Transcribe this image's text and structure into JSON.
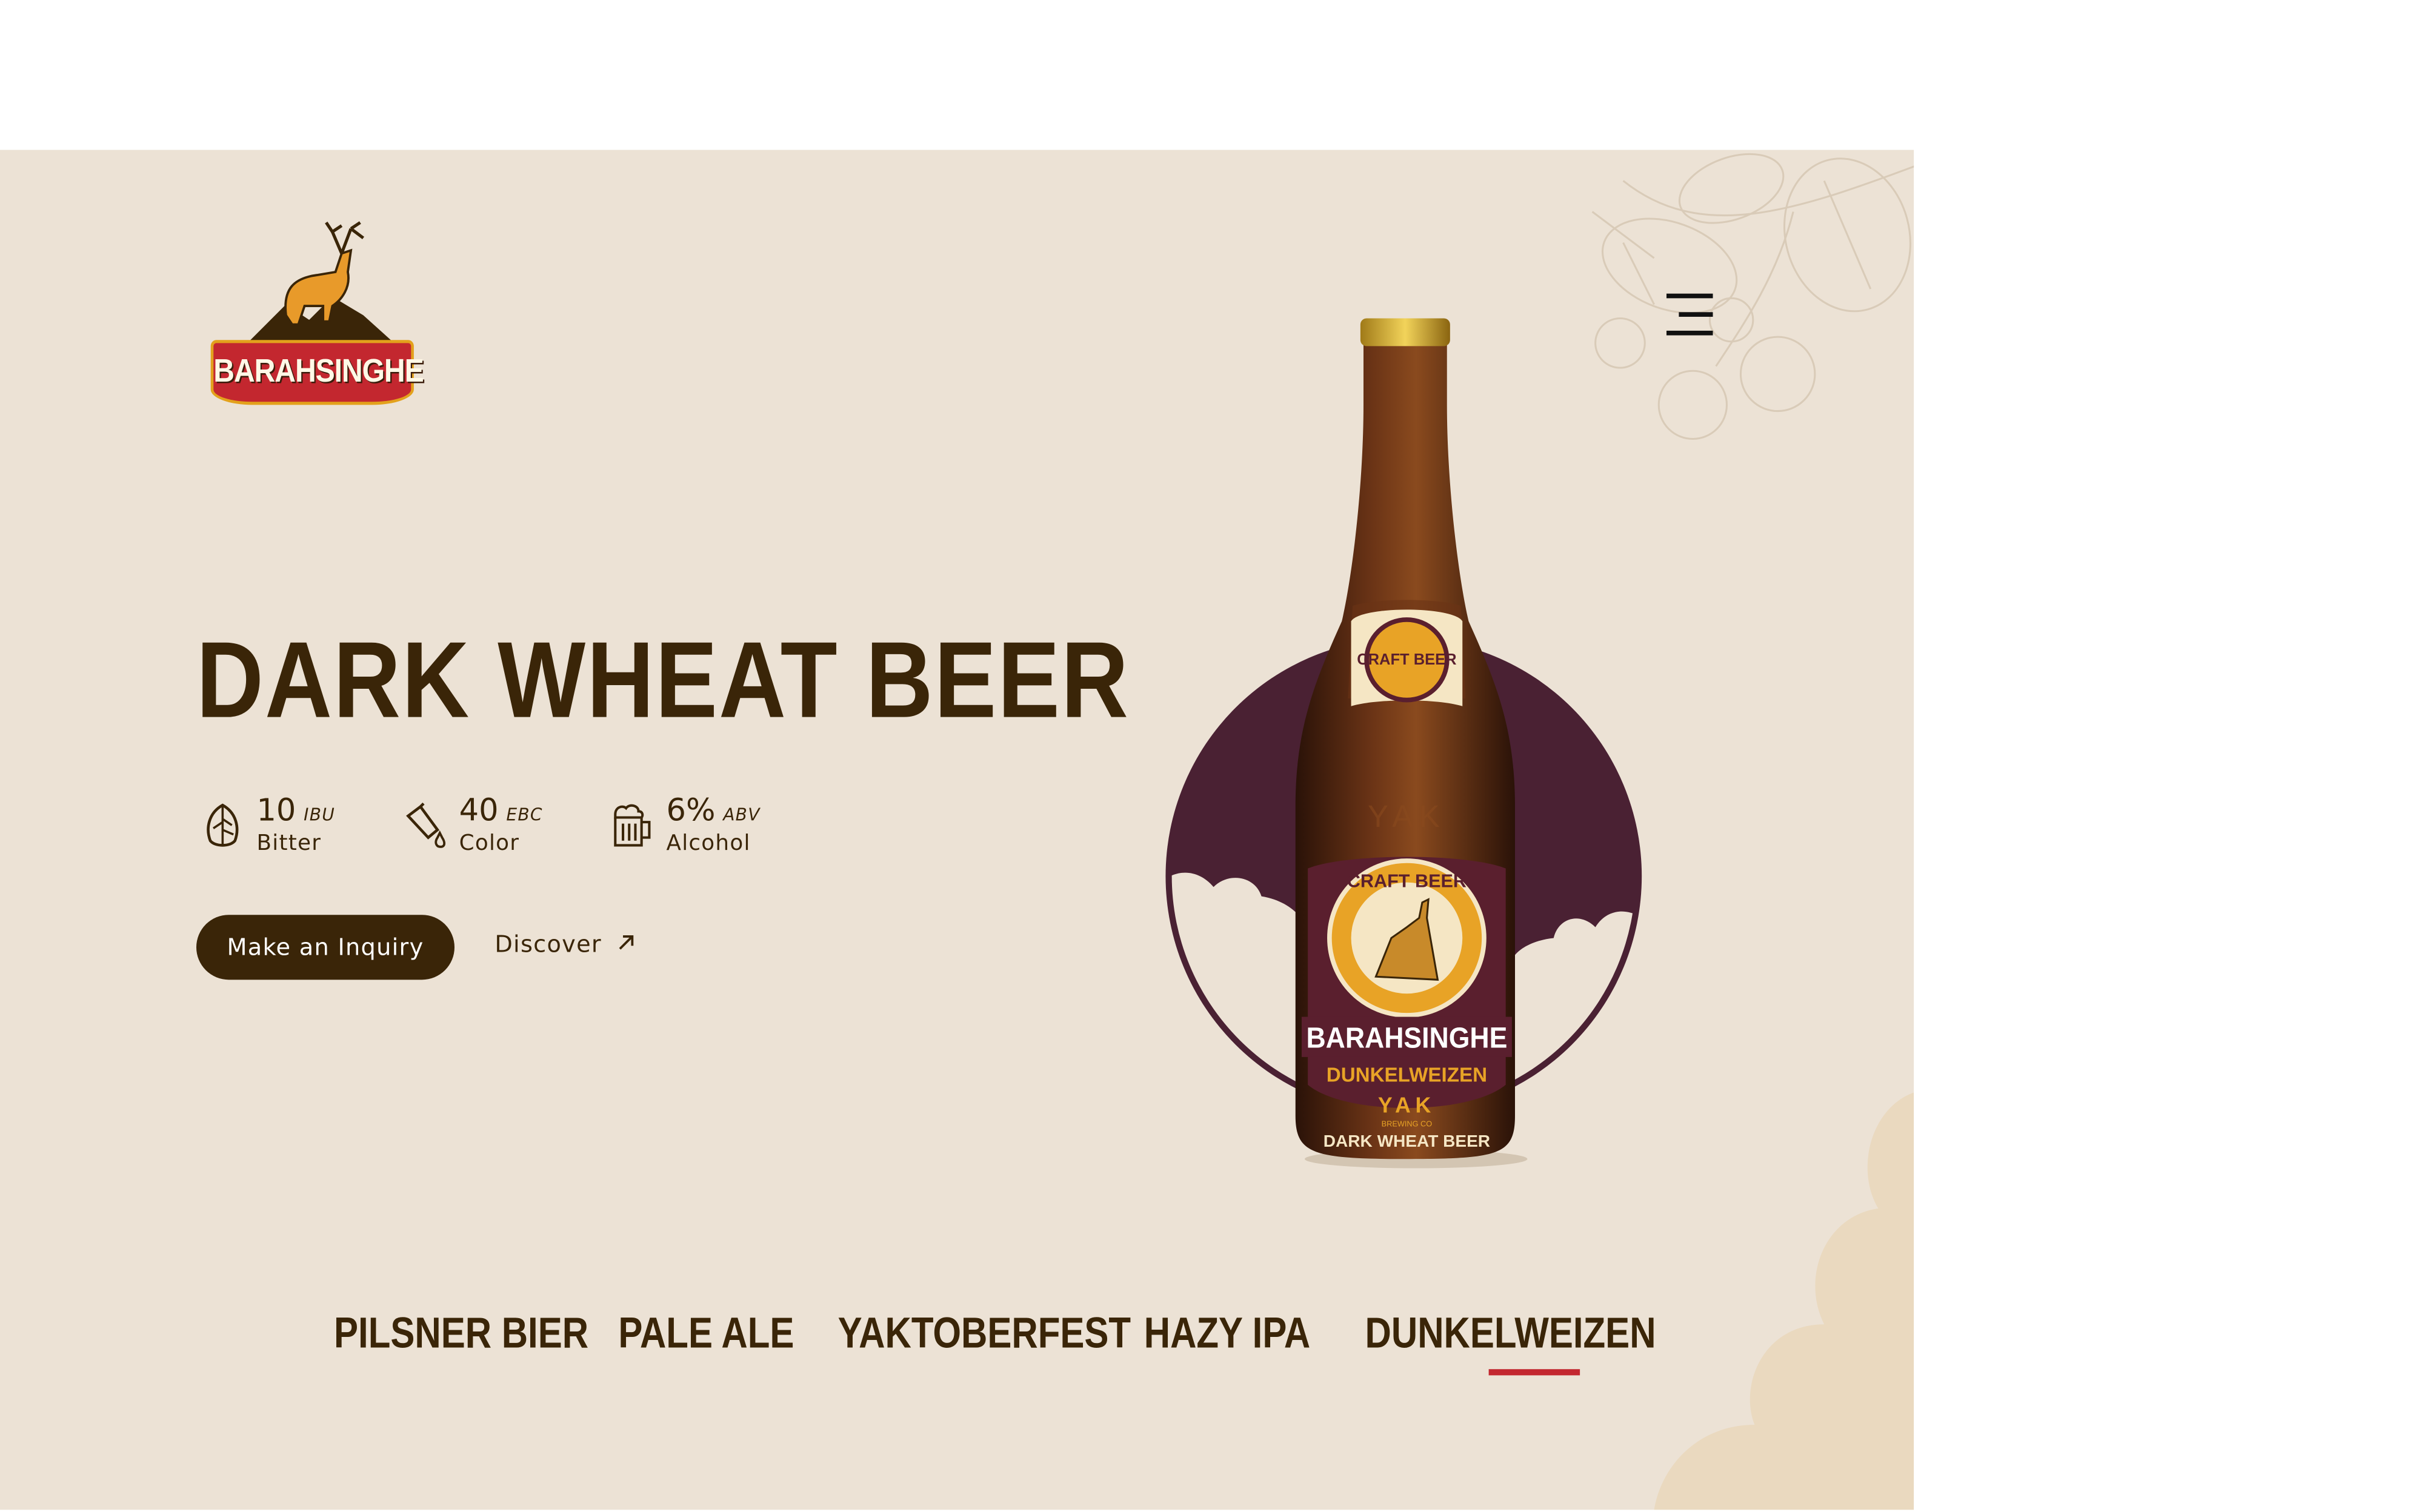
{
  "brand": {
    "logo_text": "BARAHSINGHE"
  },
  "header": {
    "menu_icon": "hamburger-menu-icon"
  },
  "hero": {
    "title": "DARK WHEAT BEER",
    "stats": [
      {
        "value": "10",
        "unit": "IBU",
        "label": "Bitter",
        "icon": "hop-leaf-icon"
      },
      {
        "value": "40",
        "unit": "EBC",
        "label": "Color",
        "icon": "pour-bottle-icon"
      },
      {
        "value": "6%",
        "unit": "ABV",
        "label": "Alcohol",
        "icon": "beer-mug-icon"
      }
    ],
    "inquiry_label": "Make an Inquiry",
    "discover_label": "Discover",
    "discover_icon": "arrow-up-right-icon"
  },
  "bottle": {
    "embossed": "YAK",
    "label_top": "CRAFT BEER",
    "label_brand": "BARAHSINGHE",
    "label_style": "DUNKELWEIZEN",
    "label_brewery": "YAK",
    "label_brewery_sub": "BREWING CO",
    "label_bottom": "DARK WHEAT BEER"
  },
  "tabs": {
    "items": [
      "PILSNER BIER",
      "PALE ALE",
      "YAKTOBERFEST",
      "HAZY IPA",
      "DUNKELWEIZEN"
    ],
    "active": "DUNKELWEIZEN"
  },
  "colors": {
    "background": "#ece2d5",
    "text_dark": "#3a2508",
    "accent_red": "#c3272f",
    "circle_plum": "#4a2133",
    "logo_gold": "#e3a11c"
  }
}
